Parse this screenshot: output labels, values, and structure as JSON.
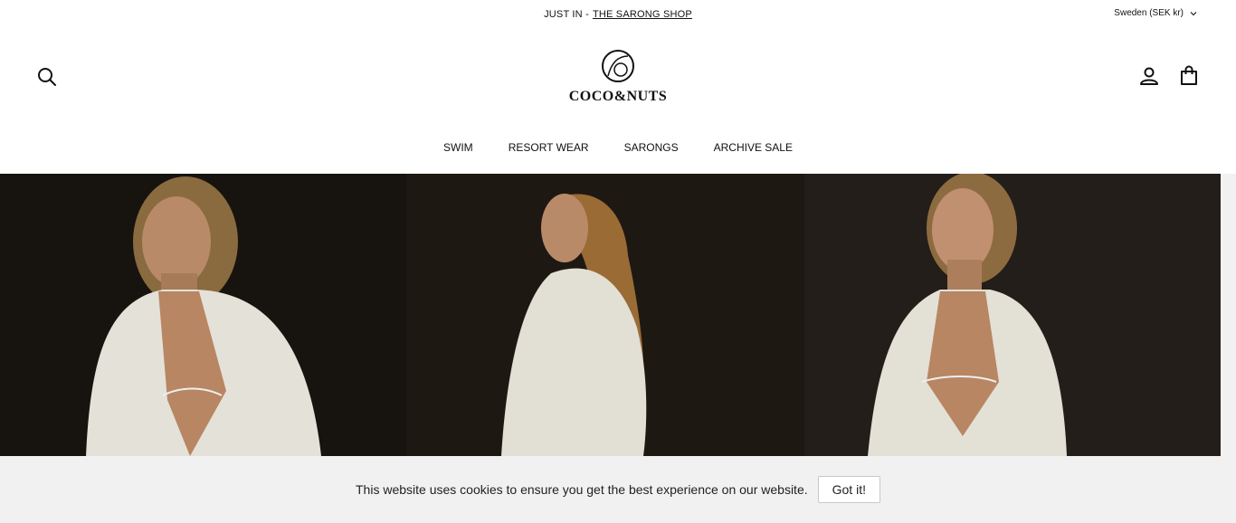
{
  "announcement": {
    "prefix": "JUST IN -",
    "link_label": "THE SARONG SHOP"
  },
  "currency": {
    "label": "Sweden (SEK kr)",
    "icon": "chevron-down-icon"
  },
  "header": {
    "brand": "COCO&NUTS",
    "icons": [
      "search-icon",
      "account-icon",
      "cart-icon"
    ]
  },
  "nav": {
    "items": [
      {
        "label": "SWIM"
      },
      {
        "label": "RESORT WEAR"
      },
      {
        "label": "SARONGS"
      },
      {
        "label": "ARCHIVE SALE"
      }
    ]
  },
  "cookie": {
    "message": "This website uses cookies to ensure you get the best experience on our website.",
    "button_label": "Got it!"
  },
  "colors": {
    "text": "#111111",
    "banner_bg": "#f1f1f1",
    "hero_bg": "#1e1813"
  }
}
